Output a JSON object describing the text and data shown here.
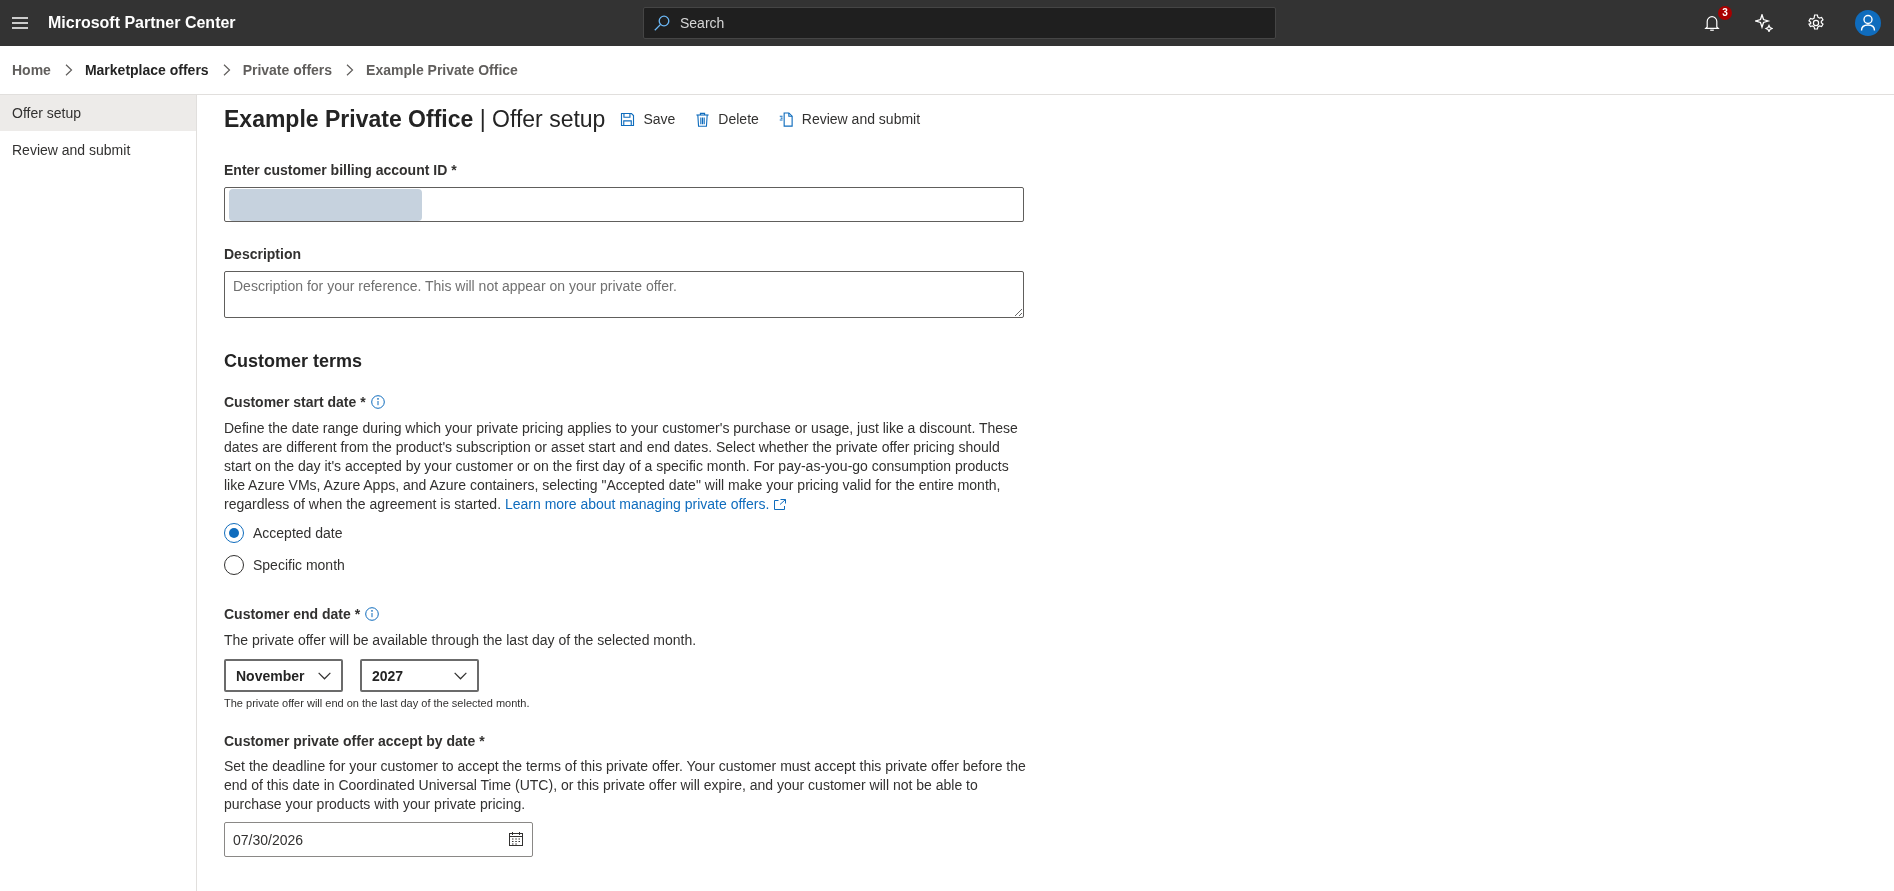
{
  "top_bar": {
    "title": "Microsoft Partner Center",
    "search": {
      "placeholder": "Search"
    },
    "notifications": {
      "count": "3"
    }
  },
  "breadcrumb": [
    {
      "label": "Home",
      "emphasized": false
    },
    {
      "label": "Marketplace offers",
      "emphasized": true
    },
    {
      "label": "Private offers",
      "emphasized": false
    },
    {
      "label": "Example Private Office",
      "emphasized": false
    }
  ],
  "sidebar": {
    "items": [
      {
        "label": "Offer setup",
        "selected": true
      },
      {
        "label": "Review and submit",
        "selected": false
      }
    ]
  },
  "header": {
    "title": "**Example Private Office** | Offer setup",
    "actions": [
      {
        "kind": "save",
        "label": "Save"
      },
      {
        "kind": "delete",
        "label": "Delete"
      },
      {
        "kind": "review",
        "label": "Review and submit"
      }
    ]
  },
  "billing_account": {
    "label": "Enter customer billing account ID *",
    "redacted": true
  },
  "description": {
    "label": "Description",
    "placeholder": "Description for your reference. This will not appear on your private offer."
  },
  "customer_terms": {
    "heading": "Customer terms",
    "start_date": {
      "label": "Customer start date *",
      "info": true,
      "text": "Define the date range during which your private pricing applies to your customer's purchase or usage, just like a discount. These dates are different from the product's subscription or asset start and end dates. Select whether the private offer pricing should start on the day it's accepted by your customer or on the first day of a specific month. For pay-as-you-go consumption products like Azure VMs, Azure Apps, and Azure containers, selecting \"Accepted date\" will make your pricing valid for the entire month, regardless of when the agreement is started.",
      "link": "Learn more about managing private offers.",
      "options": [
        {
          "label": "Accepted date",
          "selected": true
        },
        {
          "label": "Specific month",
          "selected": false
        }
      ]
    },
    "end_date": {
      "label": "Customer end date *",
      "info": true,
      "text": "The private offer will be available through the last day of the selected month.",
      "month": "November",
      "year": "2027",
      "hint": "The private offer will end on the last day of the selected month."
    },
    "accept_by": {
      "label": "Customer private offer accept by date *",
      "text": "Set the deadline for your customer to accept the terms of this private offer. Your customer must accept this private offer before the end of this date in Coordinated Universal Time (UTC), or this private offer will expire, and your customer will not be able to purchase your products with your private pricing.",
      "value": "07/30/2026"
    }
  }
}
